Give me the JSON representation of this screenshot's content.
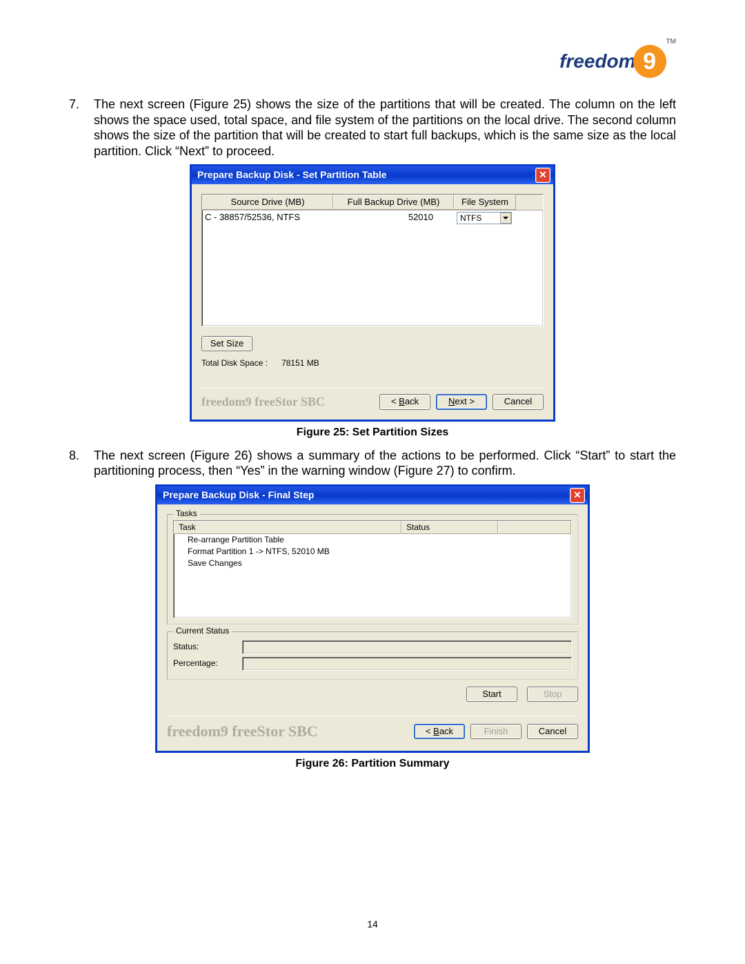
{
  "logo": {
    "brand": "freedom",
    "digit": "9",
    "tm": "TM"
  },
  "para7": {
    "num": "7.",
    "text": "The next screen (Figure 25) shows the size of the partitions that will be created.  The column on the left shows the space used, total space, and file system of the partitions on the local drive.  The second column shows the size of the partition that will be created to start full backups, which is the same size as the local partition.  Click “Next” to proceed."
  },
  "dialog1": {
    "title": "Prepare Backup Disk - Set Partition Table",
    "columns": {
      "c1": "Source Drive (MB)",
      "c2": "Full Backup Drive (MB)",
      "c3": "File System"
    },
    "row": {
      "source": "C - 38857/52536, NTFS",
      "backup": "52010",
      "fs": "NTFS"
    },
    "setSize": "Set Size",
    "totalLabel": "Total Disk Space :",
    "totalValue": "78151 MB",
    "brand": "freedom9 freeStor SBC",
    "back": "< Back",
    "next": "Next >",
    "cancel": "Cancel"
  },
  "caption1": "Figure 25: Set Partition Sizes",
  "para8": {
    "num": "8.",
    "text": "The next screen (Figure 26) shows a summary of the actions to be performed.  Click “Start” to start the partitioning process, then “Yes” in the warning window (Figure 27) to confirm."
  },
  "dialog2": {
    "title": "Prepare Backup Disk - Final Step",
    "tasksLegend": "Tasks",
    "taskCol": "Task",
    "statusCol": "Status",
    "tasks": [
      "Re-arrange Partition Table",
      "Format Partition 1 -> NTFS, 52010 MB",
      "Save Changes"
    ],
    "currentLegend": "Current Status",
    "statusLabel": "Status:",
    "percentLabel": "Percentage:",
    "start": "Start",
    "stop": "Stop",
    "brand": "freedom9 freeStor SBC",
    "back": "< Back",
    "finish": "Finish",
    "cancel": "Cancel"
  },
  "caption2": "Figure 26: Partition Summary",
  "pageNumber": "14"
}
